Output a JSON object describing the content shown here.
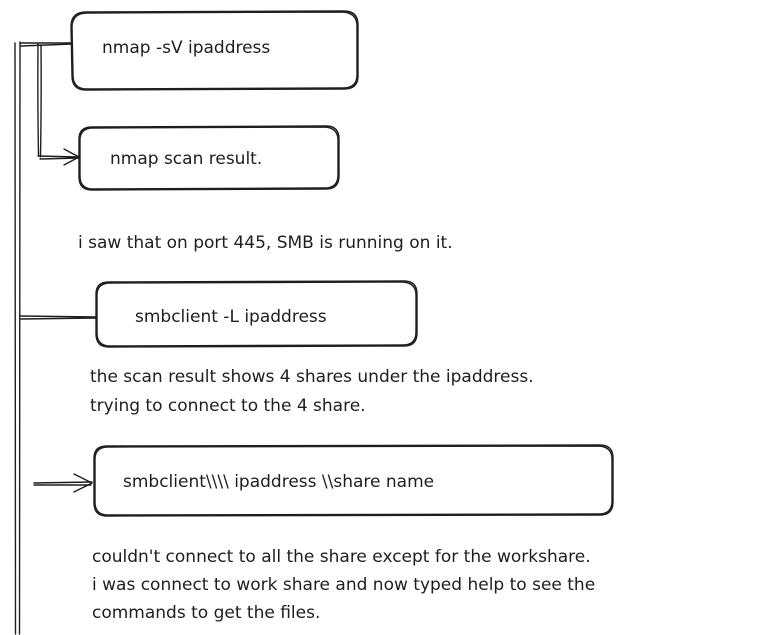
{
  "diagram": {
    "nodes": [
      {
        "id": "nmap-command",
        "label": "nmap -sV ipaddress"
      },
      {
        "id": "nmap-result",
        "label": "nmap scan result."
      },
      {
        "id": "smbclient-list",
        "label": "smbclient -L ipaddress"
      },
      {
        "id": "smbclient-connect",
        "label": "smbclient\\\\\\\\ ipaddress \\\\share name"
      }
    ],
    "notes": [
      {
        "id": "smb-observation",
        "lines": [
          "i saw that on port 445, SMB is running on it."
        ]
      },
      {
        "id": "shares-found",
        "lines": [
          "the scan result shows 4 shares under the ipaddress.",
          "trying to connect to the 4 share."
        ]
      },
      {
        "id": "workshare-connected",
        "lines": [
          "couldn't connect to all the share except for the workshare.",
          "i was connect to work share and now typed help to see the",
          "commands to get the files."
        ]
      }
    ],
    "stroke_color": "#1e1e1e",
    "background_color": "#ffffff"
  }
}
